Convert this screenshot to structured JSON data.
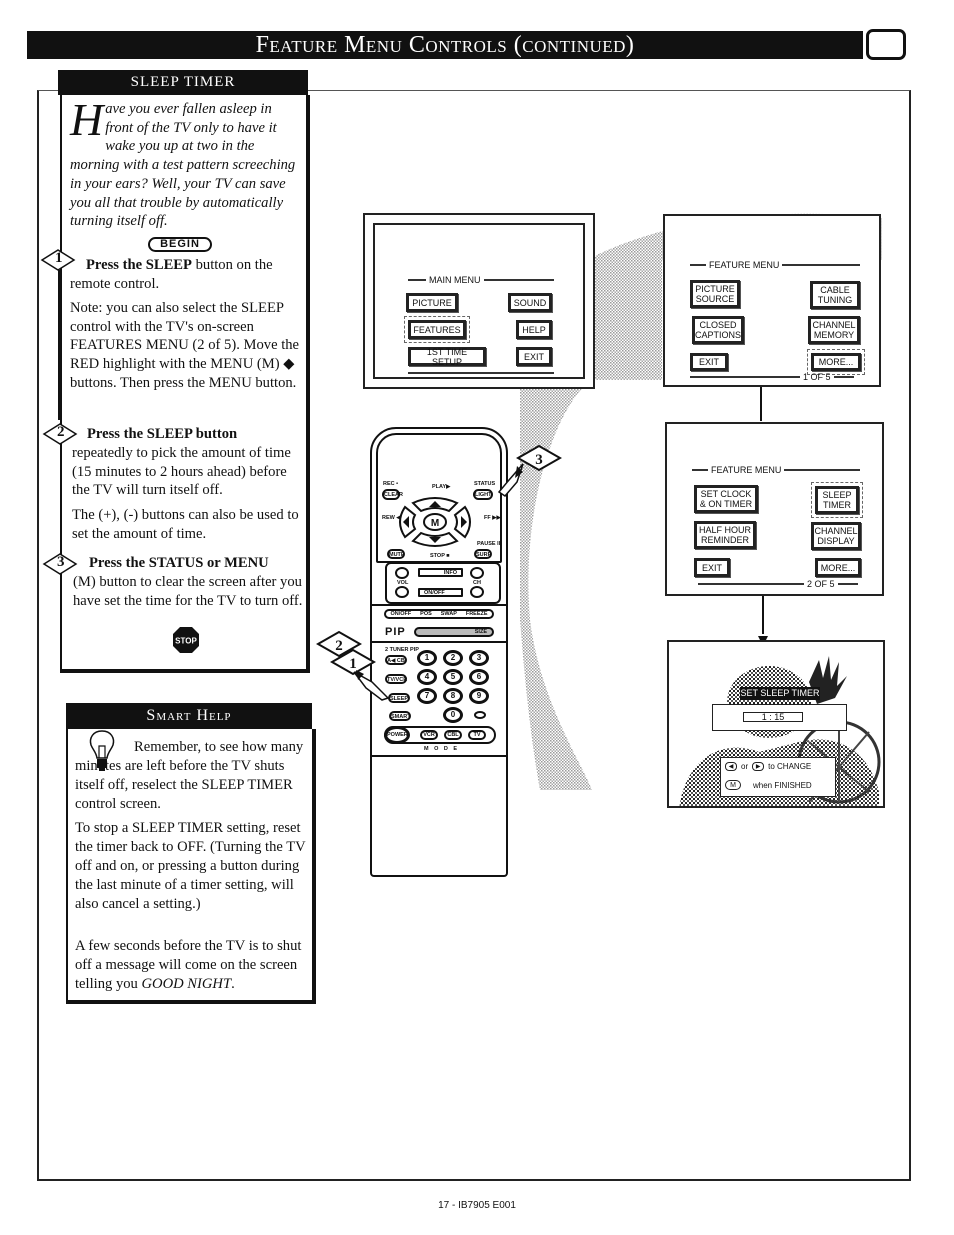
{
  "header": {
    "title": "Feature Menu Controls (continued)",
    "tv_icon": "tv-screen-icon"
  },
  "sleep_timer": {
    "section_title": "SLEEP TIMER",
    "intro_dropcap": "H",
    "intro_text": "ave you ever fallen asleep in front of the TV only to have it wake you up at two in the morning with a test pattern screeching in your ears?  Well, your TV can save you all that trouble by automatically turning itself off.",
    "begin_label": "BEGIN",
    "steps": [
      {
        "number": "1",
        "heading": "Press the SLEEP",
        "heading_rest": " button on the remote control.",
        "note": "Note: you can also select the SLEEP control with the TV's on-screen FEATURES MENU (2 of 5). Move the RED highlight with the MENU (M) ◆ buttons. Then press the MENU button."
      },
      {
        "number": "2",
        "heading": "Press the SLEEP button",
        "heading_rest": "",
        "body": "repeatedly to pick the amount of time (15 minutes to 2 hours ahead) before the TV will turn itself off.",
        "note": "The (+), (-) buttons can also be used to set the amount of time."
      },
      {
        "number": "3",
        "heading": "Press the STATUS or MENU",
        "heading_rest": "",
        "body": "(M) button to clear the screen after you have set the time for the TV to turn off."
      }
    ],
    "stop_label": "STOP"
  },
  "smart_help": {
    "title": "Smart Help",
    "paragraphs": [
      "Remember,  to see how many minutes are left before the TV shuts itself off, reselect the SLEEP TIMER control screen.",
      "To stop a SLEEP TIMER setting, reset the timer back to OFF. (Turning the TV off and on, or pressing a button during the last minute of a timer setting, will also cancel a setting.)",
      "A few seconds before the TV is to shut off a message will come on the screen telling you "
    ],
    "good_night": "GOOD NIGHT",
    "good_night_suffix": "."
  },
  "main_menu_screen": {
    "title": "MAIN MENU",
    "buttons": [
      "PICTURE",
      "SOUND",
      "FEATURES",
      "HELP",
      "1ST TIME SETUP",
      "EXIT"
    ],
    "highlighted": "FEATURES"
  },
  "feature_menu_1": {
    "title": "FEATURE MENU",
    "buttons": [
      "PICTURE SOURCE",
      "CABLE TUNING",
      "CLOSED CAPTIONS",
      "CHANNEL MEMORY",
      "EXIT",
      "MORE..."
    ],
    "highlighted": "MORE...",
    "page": "1 OF 5"
  },
  "feature_menu_2": {
    "title": "FEATURE MENU",
    "buttons": [
      "SET CLOCK & ON TIMER",
      "SLEEP TIMER",
      "HALF HOUR REMINDER",
      "CHANNEL DISPLAY",
      "EXIT",
      "MORE..."
    ],
    "highlighted": "SLEEP TIMER",
    "page": "2 OF 5"
  },
  "sleep_screen": {
    "title": "SET SLEEP TIMER",
    "value": "1 : 15",
    "hint_change_or": "or",
    "hint_change": "to CHANGE",
    "hint_m": "M",
    "hint_finished": "when FINISHED"
  },
  "remote": {
    "labels": {
      "rec": "REC •",
      "clear": "CLEAR",
      "play": "PLAY▶",
      "status": "STATUS",
      "light": "LIGHT",
      "rew": "REW ◀◀",
      "ff": "FF ▶▶",
      "menu": "MENU",
      "m": "M",
      "mute": "MUTE",
      "stop": "STOP ■",
      "pause": "PAUSE II",
      "surf": "SURF",
      "vol": "VOL",
      "ch": "CH",
      "info": "INFO",
      "onoff": "ON/OFF",
      "pip_onoff": "ON/OFF",
      "pos": "POS",
      "swap": "SWAP",
      "freeze": "FREEZE",
      "pip": "PIP",
      "size": "SIZE",
      "two_tuner": "2 TUNER PIP",
      "ab": "A◀ CB",
      "tvvcr": "TV/VCR",
      "sleep": "SLEEP",
      "smart": "SMART",
      "power": "POWER",
      "vcr": "VCR",
      "cbl": "CBL",
      "tv": "TV",
      "mode": "M  O  D  E"
    },
    "number_keys": [
      "1",
      "2",
      "3",
      "4",
      "5",
      "6",
      "7",
      "8",
      "9",
      "0"
    ],
    "callouts": [
      "3",
      "2",
      "1"
    ]
  },
  "page_footer": "17 - IB7905 E001"
}
